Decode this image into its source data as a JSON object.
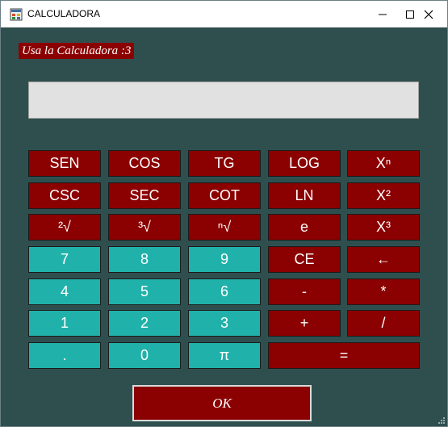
{
  "window": {
    "title": "CALCULADORA",
    "min_icon": "minimize-icon",
    "max_icon": "maximize-icon",
    "close_icon": "close-icon"
  },
  "banner": "Usa la Calculadora :3",
  "display": {
    "value": ""
  },
  "rows": [
    [
      {
        "label": "SEN",
        "style": "red"
      },
      {
        "label": "COS",
        "style": "red"
      },
      {
        "label": "TG",
        "style": "red"
      },
      {
        "label": "LOG",
        "style": "red"
      },
      {
        "label": "Xⁿ",
        "style": "red"
      }
    ],
    [
      {
        "label": "CSC",
        "style": "red"
      },
      {
        "label": "SEC",
        "style": "red"
      },
      {
        "label": "COT",
        "style": "red"
      },
      {
        "label": "LN",
        "style": "red"
      },
      {
        "label": "X²",
        "style": "red"
      }
    ],
    [
      {
        "label": "²√",
        "style": "red"
      },
      {
        "label": "³√",
        "style": "red"
      },
      {
        "label": "ⁿ√",
        "style": "red"
      },
      {
        "label": "e",
        "style": "red"
      },
      {
        "label": "X³",
        "style": "red"
      }
    ],
    [
      {
        "label": "7",
        "style": "teal"
      },
      {
        "label": "8",
        "style": "teal"
      },
      {
        "label": "9",
        "style": "teal"
      },
      {
        "label": "CE",
        "style": "red"
      },
      {
        "label": "←",
        "style": "red"
      }
    ],
    [
      {
        "label": "4",
        "style": "teal"
      },
      {
        "label": "5",
        "style": "teal"
      },
      {
        "label": "6",
        "style": "teal"
      },
      {
        "label": "-",
        "style": "red"
      },
      {
        "label": "*",
        "style": "red"
      }
    ],
    [
      {
        "label": "1",
        "style": "teal"
      },
      {
        "label": "2",
        "style": "teal"
      },
      {
        "label": "3",
        "style": "teal"
      },
      {
        "label": "+",
        "style": "red"
      },
      {
        "label": "/",
        "style": "red"
      }
    ],
    [
      {
        "label": ".",
        "style": "teal"
      },
      {
        "label": "0",
        "style": "teal"
      },
      {
        "label": "π",
        "style": "teal"
      },
      {
        "label": "=",
        "style": "red"
      }
    ]
  ],
  "ok_label": "OK",
  "colors": {
    "client": "#2f4f4f",
    "accent_red": "#8b0000",
    "accent_teal": "#20b2aa",
    "display": "#e1e1e1"
  }
}
